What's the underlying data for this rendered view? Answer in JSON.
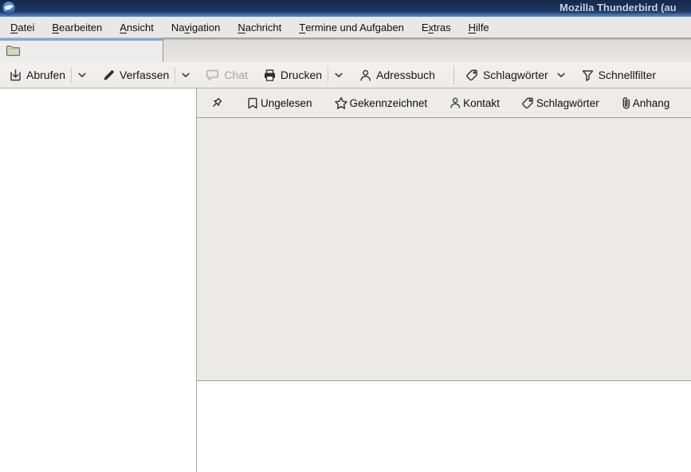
{
  "window": {
    "title": "Mozilla Thunderbird (au",
    "app_icon": "thunderbird-icon"
  },
  "menubar": {
    "items": [
      {
        "name": "datei",
        "pre": "",
        "key": "D",
        "post": "atei"
      },
      {
        "name": "bearbeiten",
        "pre": "",
        "key": "B",
        "post": "earbeiten"
      },
      {
        "name": "ansicht",
        "pre": "",
        "key": "A",
        "post": "nsicht"
      },
      {
        "name": "navigation",
        "pre": "Na",
        "key": "v",
        "post": "igation"
      },
      {
        "name": "nachricht",
        "pre": "",
        "key": "N",
        "post": "achricht"
      },
      {
        "name": "termine-und-aufgaben",
        "pre": "",
        "key": "T",
        "post": "ermine und Aufgaben"
      },
      {
        "name": "extras",
        "pre": "E",
        "key": "x",
        "post": "tras"
      },
      {
        "name": "hilfe",
        "pre": "",
        "key": "H",
        "post": "ilfe"
      }
    ]
  },
  "tabbar": {
    "tabs": [
      {
        "name": "folder-tab",
        "icon": "folder-icon",
        "label": ""
      }
    ]
  },
  "toolbar": {
    "buttons": [
      {
        "name": "get-messages",
        "label": "Abrufen",
        "icon": "get-mail-icon",
        "dropdown": true,
        "split": true
      },
      {
        "name": "compose",
        "label": "Verfassen",
        "icon": "compose-icon",
        "dropdown": true,
        "split": true
      },
      {
        "name": "chat",
        "label": "Chat",
        "icon": "chat-icon",
        "disabled": true
      },
      {
        "name": "print",
        "label": "Drucken",
        "icon": "print-icon",
        "dropdown": true,
        "split": true
      },
      {
        "name": "address-book",
        "label": "Adressbuch",
        "icon": "address-book-icon"
      },
      {
        "name": "tags",
        "label": "Schlagwörter",
        "icon": "tag-icon",
        "dropdown": true,
        "separator_before": true
      },
      {
        "name": "quick-filter",
        "label": "Schnellfilter",
        "icon": "funnel-icon"
      }
    ]
  },
  "quickfilter": {
    "pin": {
      "name": "sticky-filter",
      "icon": "pin-icon"
    },
    "filters": [
      {
        "name": "filter-unread",
        "label": "Ungelesen",
        "icon": "unread-icon"
      },
      {
        "name": "filter-starred",
        "label": "Gekennzeichnet",
        "icon": "star-icon"
      },
      {
        "name": "filter-contact",
        "label": "Kontakt",
        "icon": "contact-icon"
      },
      {
        "name": "filter-tags",
        "label": "Schlagwörter",
        "icon": "tag-icon"
      },
      {
        "name": "filter-attachment",
        "label": "Anhang",
        "icon": "attachment-icon"
      }
    ]
  },
  "colors": {
    "titlebar": "#1b3259",
    "titlebar_text": "#c8d5eb",
    "tab_accent": "#8ba5c9",
    "menubar_bg": "#e8e8e7",
    "toolbar_bg": "#f1f0ee",
    "pane_bg": "#ebeae8",
    "border": "#a29e98"
  }
}
